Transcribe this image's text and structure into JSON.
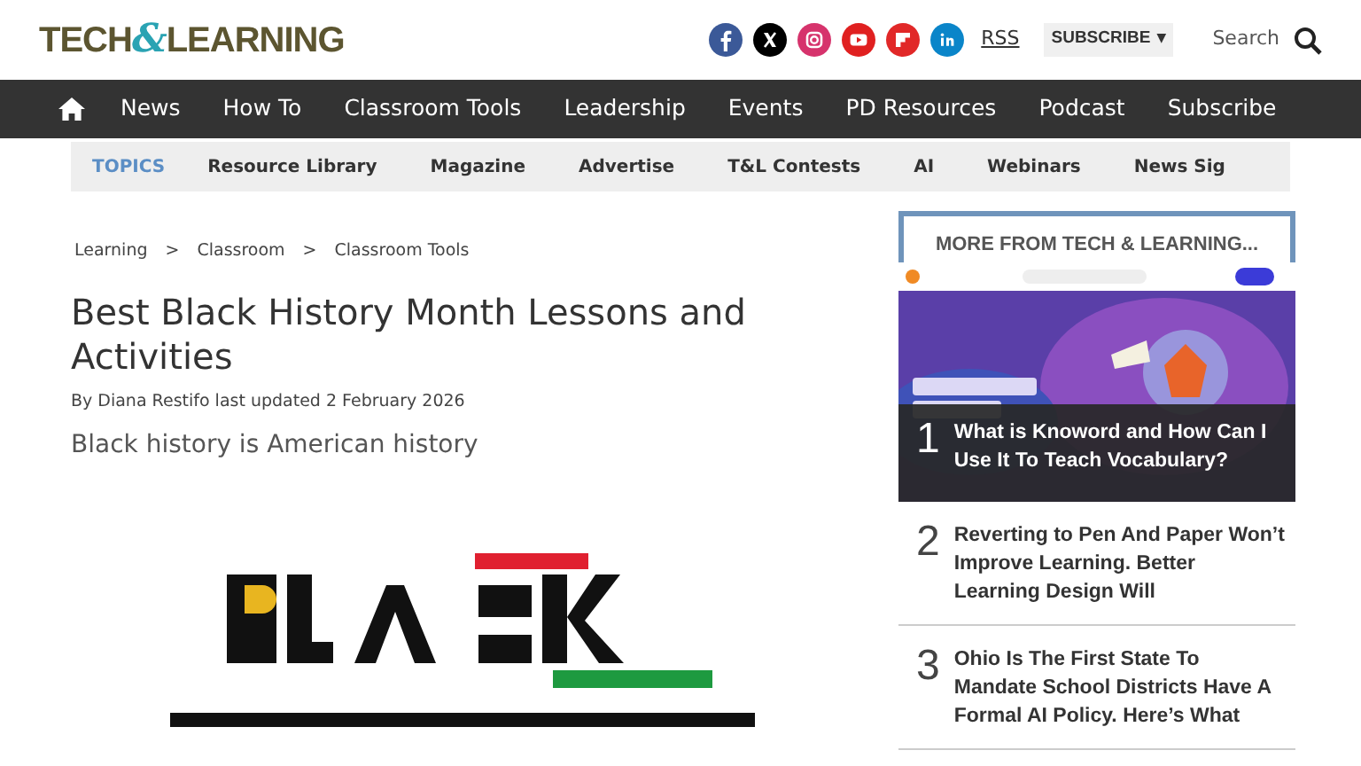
{
  "header": {
    "logo": [
      "TECH",
      "&",
      "LEARNING"
    ],
    "social": [
      {
        "kind": "facebook",
        "color": "#3b5998"
      },
      {
        "kind": "x",
        "color": "#000000"
      },
      {
        "kind": "instagram",
        "color": "#d6336c"
      },
      {
        "kind": "youtube",
        "color": "#e02020"
      },
      {
        "kind": "flipboard",
        "color": "#e12828"
      },
      {
        "kind": "linkedin",
        "color": "#0a85c9"
      }
    ],
    "rss": "RSS",
    "subscribe": "SUBSCRIBE",
    "subscribe_caret": "▾",
    "search": "Search"
  },
  "nav": {
    "items": [
      "News",
      "How To",
      "Classroom Tools",
      "Leadership",
      "Events",
      "PD Resources",
      "Podcast",
      "Subscribe"
    ]
  },
  "topics": {
    "label": "TOPICS",
    "items": [
      "Resource Library",
      "Magazine",
      "Advertise",
      "T&L Contests",
      "AI",
      "Webinars",
      "News Sig"
    ]
  },
  "breadcrumbs": [
    "Learning",
    ">",
    "Classroom",
    ">",
    "Classroom Tools"
  ],
  "article": {
    "title": "Best Black History Month Lessons and Activities",
    "byline": "By Diana Restifo last updated 2 February 2026",
    "standfirst": "Black history is American history"
  },
  "sidebar": {
    "heading": "MORE FROM TECH & LEARNING...",
    "items": [
      {
        "kind": "featured",
        "number": "1",
        "title": "What is Knoword and How Can I Use It To Teach Vocabulary?"
      },
      {
        "kind": "plain",
        "number": "2",
        "title": "Reverting to Pen And Paper Won’t Improve Learning. Better Learning Design Will"
      },
      {
        "kind": "plain",
        "number": "3",
        "title": "Ohio Is The First State To Mandate School Districts Have A Formal AI Policy. Here’s What"
      }
    ]
  }
}
